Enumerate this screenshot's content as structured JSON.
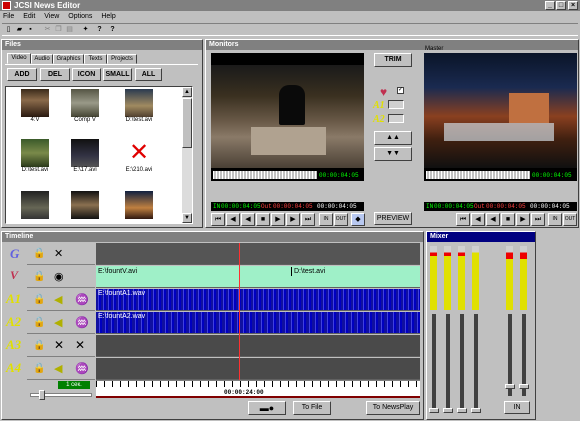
{
  "app": {
    "title": "JCSI News Editor"
  },
  "menu": [
    "File",
    "Edit",
    "View",
    "Options",
    "Help"
  ],
  "files": {
    "title": "Files",
    "tabs": [
      "Video",
      "Audio",
      "Graphics",
      "Texts",
      "Projects"
    ],
    "buttons": [
      "ADD",
      "DEL",
      "ICON",
      "SMALL",
      "ALL"
    ],
    "items": [
      {
        "label": "4:V"
      },
      {
        "label": "Comp V"
      },
      {
        "label": "D:\\test.avi"
      },
      {
        "label": "D:\\test.avi"
      },
      {
        "label": "E:\\17.avi"
      },
      {
        "label": "E:\\210.avi"
      },
      {
        "label": ""
      },
      {
        "label": ""
      },
      {
        "label": ""
      }
    ]
  },
  "monitors": {
    "title": "Monitors",
    "master_label": "Master",
    "source": {
      "tc_top": "00:00:04:05",
      "in_label": "IN",
      "in_tc": "00:00:04:05",
      "out_label": "Out",
      "out_tc": "00:00:04:05",
      "dur_tc": "00:00:04:05"
    },
    "master": {
      "tc_top": "00:00:04:05",
      "in_label": "IN",
      "in_tc": "00:00:04:05",
      "out_label": "Out",
      "out_tc": "00:00:04:05",
      "dur_tc": "00:00:04:05"
    },
    "trim_label": "TRIM",
    "preview_label": "PREVIEW",
    "a1": "A1",
    "a2": "A2",
    "in_small": "IN",
    "out_small": "OUT"
  },
  "timeline": {
    "title": "Timeline",
    "tracks": [
      {
        "name": "G",
        "clips": []
      },
      {
        "name": "V",
        "clips": [
          "E:\\fountV.avi",
          "D:\\test.avi"
        ]
      },
      {
        "name": "A1",
        "clips": [
          "E:\\fountA1.wav"
        ]
      },
      {
        "name": "A2",
        "clips": [
          "E:\\fountA2.wav"
        ]
      },
      {
        "name": "A3",
        "clips": []
      },
      {
        "name": "A4",
        "clips": []
      }
    ],
    "zoom_label": "1 сек.",
    "timecode": "00:00:24:00",
    "to_file": "To File",
    "to_newsplay": "To NewsPlay"
  },
  "mixer": {
    "title": "Mixer",
    "in_label": "IN"
  },
  "colors": {
    "accent_green": "#9ff0c8",
    "waveform": "#0000c0",
    "titlebar": "#808080",
    "tc_green": "#00ff00"
  }
}
